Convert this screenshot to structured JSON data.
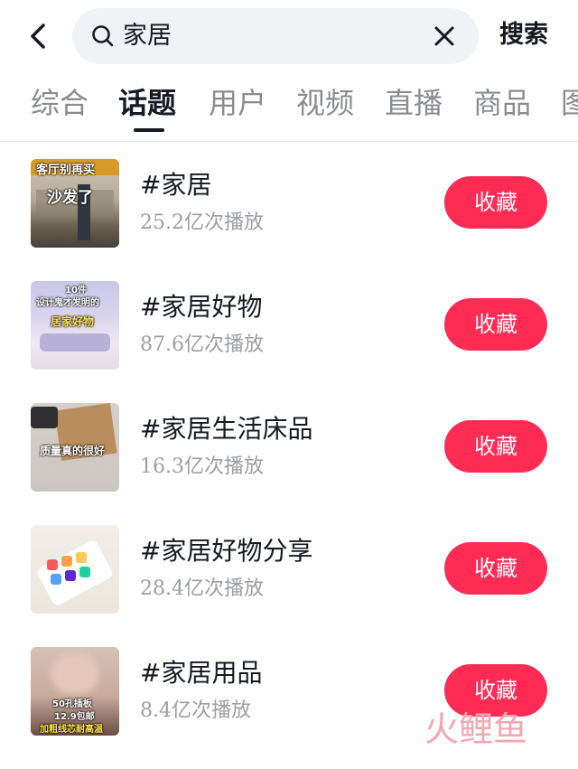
{
  "header": {
    "back_icon": "chevron-left-icon",
    "search_icon": "search-icon",
    "search_query": "家居",
    "clear_icon": "close-icon",
    "search_button": "搜索"
  },
  "tabs": [
    {
      "label": "综合",
      "active": false
    },
    {
      "label": "话题",
      "active": true
    },
    {
      "label": "用户",
      "active": false
    },
    {
      "label": "视频",
      "active": false
    },
    {
      "label": "直播",
      "active": false
    },
    {
      "label": "商品",
      "active": false
    },
    {
      "label": "图",
      "active": false
    }
  ],
  "topics": [
    {
      "title": "#家居",
      "plays": "25.2亿次播放",
      "action": "收藏",
      "thumb_text": [
        "客厅别再买",
        "沙发了"
      ]
    },
    {
      "title": "#家居好物",
      "plays": "87.6亿次播放",
      "action": "收藏",
      "thumb_text": [
        "10件",
        "设计鬼才发明的",
        "居家好物"
      ]
    },
    {
      "title": "#家居生活床品",
      "plays": "16.3亿次播放",
      "action": "收藏",
      "thumb_text": [
        "质量真的很好"
      ]
    },
    {
      "title": "#家居好物分享",
      "plays": "28.4亿次播放",
      "action": "收藏",
      "thumb_text": []
    },
    {
      "title": "#家居用品",
      "plays": "8.4亿次播放",
      "action": "收藏",
      "thumb_text": [
        "50孔插板",
        "12.9包邮",
        "加粗线芯耐高温"
      ]
    }
  ],
  "watermark": {
    "text": "火鲤鱼"
  },
  "colors": {
    "accent": "#fe2c55",
    "text_primary": "#161823",
    "text_secondary": "#9d9ea3",
    "search_bg": "#f1f2f5"
  }
}
